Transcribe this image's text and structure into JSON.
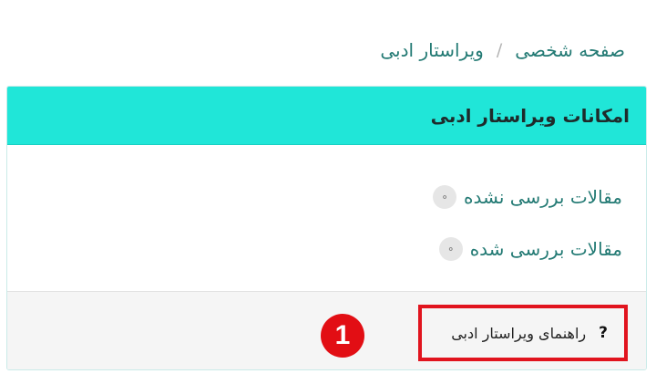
{
  "breadcrumb": {
    "items": [
      "صفحه شخصی",
      "ویراستار ادبی"
    ],
    "separator": "/"
  },
  "card": {
    "title": "امکانات ویراستار ادبی",
    "header_color": "#20e6d8",
    "menu": [
      {
        "label": "مقالات بررسی نشده",
        "icon": "circle-bullet-icon"
      },
      {
        "label": "مقالات بررسی شده",
        "icon": "circle-bullet-icon"
      }
    ],
    "footer": {
      "help_label": "راهنمای ویراستار ادبی",
      "help_icon": "?"
    }
  },
  "annotation": {
    "badge_number": "1",
    "highlight_color": "#e1141e"
  }
}
